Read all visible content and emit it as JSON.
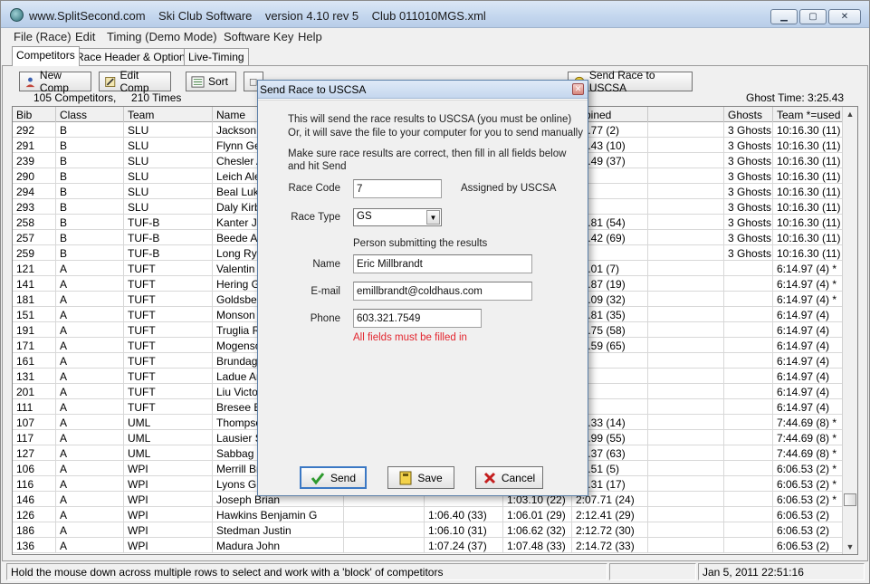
{
  "window": {
    "title": "www.SplitSecond.com    Ski Club Software    version 4.10 rev 5    Club 011010MGS.xml",
    "minimize": "▁",
    "maximize": "▢",
    "close": "✕"
  },
  "menu": [
    "File (Race)",
    "Edit",
    "Timing (Demo Mode)",
    "Software Key",
    "Help"
  ],
  "tabs": [
    "Competitors",
    "Race Header & Options",
    "Live-Timing"
  ],
  "toolbar": {
    "new_comp": "New Comp",
    "edit_comp": "Edit Comp",
    "sort": "Sort",
    "send_race": "Send Race to USCSA"
  },
  "counts_text": "105 Competitors,     210 Times",
  "ghost_time": "Ghost Time: 3:25.43",
  "grid": {
    "headers": {
      "bib": "Bib",
      "class": "Class",
      "team": "Team",
      "name": "Name",
      "combined": "mbined",
      "ghosts": "Ghosts",
      "team_used": "Team *=used"
    },
    "rows": [
      [
        "292",
        "B",
        "SLU",
        "Jackson A",
        "",
        "",
        "52.77 (2)",
        "3 Ghosts",
        "10:16.30 (11)"
      ],
      [
        "291",
        "B",
        "SLU",
        "Flynn Geo",
        "",
        "",
        "59.43 (10)",
        "3 Ghosts",
        "10:16.30 (11)"
      ],
      [
        "239",
        "B",
        "SLU",
        "Chesler A",
        "",
        "",
        "19.49 (37)",
        "3 Ghosts",
        "10:16.30 (11)"
      ],
      [
        "290",
        "B",
        "SLU",
        "Leich Alex",
        "",
        "",
        "",
        "3 Ghosts",
        "10:16.30 (11)"
      ],
      [
        "294",
        "B",
        "SLU",
        "Beal Luke",
        "",
        "",
        "",
        "3 Ghosts",
        "10:16.30 (11)"
      ],
      [
        "293",
        "B",
        "SLU",
        "Daly Kirby",
        "",
        "",
        "",
        "3 Ghosts",
        "10:16.30 (11)"
      ],
      [
        "258",
        "B",
        "TUF-B",
        "Kanter Jus",
        "",
        "",
        "43.81 (54)",
        "3 Ghosts",
        "10:16.30 (11)"
      ],
      [
        "257",
        "B",
        "TUF-B",
        "Beede Ale",
        "",
        "",
        "19.42 (69)",
        "3 Ghosts",
        "10:16.30 (11)"
      ],
      [
        "259",
        "B",
        "TUF-B",
        "Long Rya",
        "",
        "",
        "",
        "3 Ghosts",
        "10:16.30 (11)"
      ],
      [
        "121",
        "A",
        "TUFT",
        "Valentin T",
        "",
        "",
        "57.01 (7)",
        "",
        "6:14.97 (4) *"
      ],
      [
        "141",
        "A",
        "TUFT",
        "Hering Gre",
        "",
        "",
        "04.87 (19)",
        "",
        "6:14.97 (4) *"
      ],
      [
        "181",
        "A",
        "TUFT",
        "Goldsberg",
        "",
        "",
        "13.09 (32)",
        "",
        "6:14.97 (4) *"
      ],
      [
        "151",
        "A",
        "TUFT",
        "Monson S",
        "",
        "",
        "16.81 (35)",
        "",
        "6:14.97 (4)"
      ],
      [
        "191",
        "A",
        "TUFT",
        "Truglia Ro",
        "",
        "",
        "49.75 (58)",
        "",
        "6:14.97 (4)"
      ],
      [
        "171",
        "A",
        "TUFT",
        "Mogenson",
        "",
        "",
        "02.59 (65)",
        "",
        "6:14.97 (4)"
      ],
      [
        "161",
        "A",
        "TUFT",
        "Brundage",
        "",
        "",
        "",
        "",
        "6:14.97 (4)"
      ],
      [
        "131",
        "A",
        "TUFT",
        "Ladue Arli",
        "",
        "",
        "",
        "",
        "6:14.97 (4)"
      ],
      [
        "201",
        "A",
        "TUFT",
        "Liu Victor",
        "",
        "",
        "",
        "",
        "6:14.97 (4)"
      ],
      [
        "111",
        "A",
        "TUFT",
        "Bresee Br",
        "",
        "",
        "",
        "",
        "6:14.97 (4)"
      ],
      [
        "107",
        "A",
        "UML",
        "Thompson",
        "",
        "",
        "01.33 (14)",
        "",
        "7:44.69 (8) *"
      ],
      [
        "117",
        "A",
        "UML",
        "Lausier St",
        "",
        "",
        "44.99 (55)",
        "",
        "7:44.69 (8) *"
      ],
      [
        "127",
        "A",
        "UML",
        "Sabbag N",
        "",
        "",
        "58.37 (63)",
        "",
        "7:44.69 (8) *"
      ],
      [
        "106",
        "A",
        "WPI",
        "Merrill Bra",
        "",
        "",
        "54.51 (5)",
        "",
        "6:06.53 (2) *"
      ],
      [
        "116",
        "A",
        "WPI",
        "Lyons Gre",
        "",
        "",
        "04.31 (17)",
        "",
        "6:06.53 (2) *"
      ],
      [
        "146",
        "A",
        "WPI",
        "Joseph Brian",
        "",
        "1:03.10 (22)",
        "2:07.71 (24)",
        "",
        "6:06.53 (2) *"
      ],
      [
        "126",
        "A",
        "WPI",
        "Hawkins Benjamin G",
        "1:06.40 (33)",
        "1:06.01 (29)",
        "2:12.41 (29)",
        "",
        "6:06.53 (2)"
      ],
      [
        "186",
        "A",
        "WPI",
        "Stedman Justin",
        "1:06.10 (31)",
        "1:06.62 (32)",
        "2:12.72 (30)",
        "",
        "6:06.53 (2)"
      ],
      [
        "136",
        "A",
        "WPI",
        "Madura John",
        "1:07.24 (37)",
        "1:07.48 (33)",
        "2:14.72 (33)",
        "",
        "6:06.53 (2)"
      ]
    ]
  },
  "status": {
    "hint": "Hold the mouse down across multiple rows to select and work with a 'block' of competitors",
    "datetime": "Jan 5, 2011   22:51:16"
  },
  "dialog": {
    "title": "Send Race to USCSA",
    "close": "✕",
    "intro_line1": "This will send the race results to USCSA (you must be online)",
    "intro_line2": "Or, it will save the file to your computer for you to send manually",
    "instr_line1": "Make sure race results are correct, then fill in all fields below",
    "instr_line2": "and hit Send",
    "race_code_label": "Race Code",
    "race_code_value": "7",
    "assigned_text": "Assigned by USCSA",
    "race_type_label": "Race Type",
    "race_type_value": "GS",
    "person_heading": "Person submitting the results",
    "name_label": "Name",
    "name_value": "Eric Millbrandt",
    "email_label": "E-mail",
    "email_value": "emillbrandt@coldhaus.com",
    "phone_label": "Phone",
    "phone_value": "603.321.7549",
    "error_text": "All fields must be filled in",
    "send_label": "Send",
    "save_label": "Save",
    "cancel_label": "Cancel"
  },
  "colors": {
    "error": "#e3262f",
    "send_check": "#2e9a2e",
    "cancel_x": "#c41f1f",
    "focus_border": "#3b78c4"
  }
}
